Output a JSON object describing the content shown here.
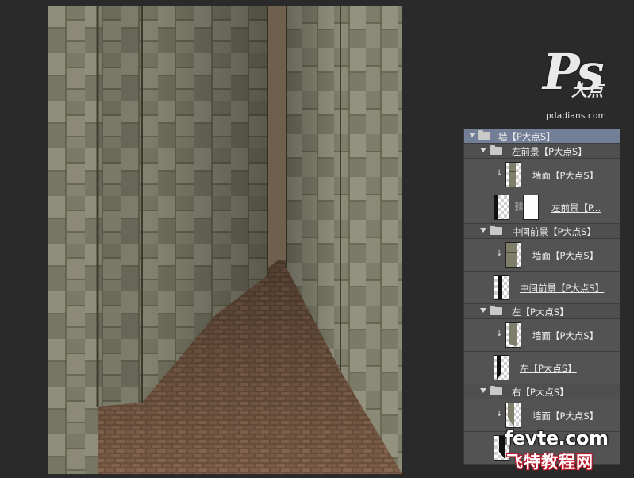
{
  "watermark": {
    "ps": "Ps",
    "brand_cn": "大点",
    "url": "pdadians.com"
  },
  "layers_panel": {
    "rows": [
      {
        "kind": "group",
        "name": "墙【P大点S】",
        "expanded": true,
        "selected": true,
        "indent": 0
      },
      {
        "kind": "group",
        "name": "左前景【P大点S】",
        "expanded": true,
        "selected": false,
        "indent": 1
      },
      {
        "kind": "layer",
        "name": "墙面【P大点S】",
        "clipped": true,
        "thumbnail": "wall-texture"
      },
      {
        "kind": "layer",
        "name": "左前景【P...",
        "clipped": false,
        "has_mask": true,
        "thumbnail": "shape-left-foreground"
      },
      {
        "kind": "group",
        "name": "中间前景【P大点S】",
        "expanded": true,
        "selected": false,
        "indent": 1
      },
      {
        "kind": "layer",
        "name": "墙面【P大点S】",
        "clipped": true,
        "thumbnail": "wall-texture"
      },
      {
        "kind": "layer",
        "name": "中间前景【P大点S】",
        "clipped": false,
        "thumbnail": "shape-middle-foreground"
      },
      {
        "kind": "group",
        "name": "左【P大点S】",
        "expanded": true,
        "selected": false,
        "indent": 1
      },
      {
        "kind": "layer",
        "name": "墙面【P大点S】",
        "clipped": true,
        "thumbnail": "wall-texture"
      },
      {
        "kind": "layer",
        "name": "左【P大点S】",
        "clipped": false,
        "thumbnail": "shape-left"
      },
      {
        "kind": "group",
        "name": "右【P大点S】",
        "expanded": true,
        "selected": false,
        "indent": 1
      },
      {
        "kind": "layer",
        "name": "墙面【P大点S】",
        "clipped": true,
        "thumbnail": "wall-texture"
      },
      {
        "kind": "layer",
        "name": "",
        "clipped": false,
        "thumbnail": "shape-right"
      }
    ]
  },
  "site_badge": {
    "domain": "fevte.com",
    "name_cn": "飞特教程网"
  },
  "colors": {
    "panel_bg": "#535353",
    "selected_row": "#727f97",
    "app_bg": "#2a2a2a",
    "stone": "#8a8a78",
    "floor": "#7a5c45",
    "sky": "#6e604f"
  }
}
